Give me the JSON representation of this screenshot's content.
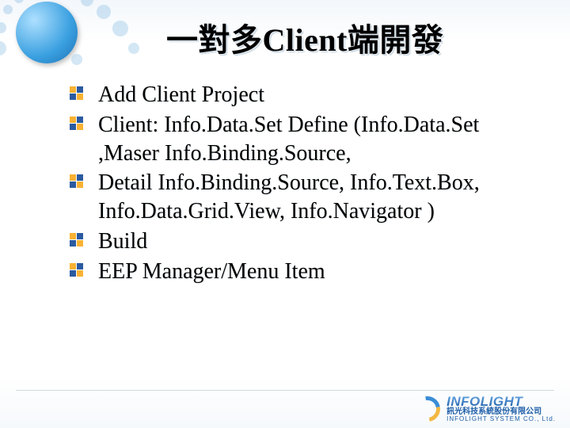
{
  "title": "一對多Client端開發",
  "bullets": [
    "Add Client Project",
    "Client: Info.Data.Set Define (Info.Data.Set ,Maser Info.Binding.Source,",
    "   Detail Info.Binding.Source, Info.Text.Box, Info.Data.Grid.View, Info.Navigator )",
    "Build",
    "EEP Manager/Menu Item"
  ],
  "footer": {
    "brand_latin": "INFOLIGHT",
    "brand_cn": "訊光科技系統股份有限公司",
    "brand_en": "INFOLIGHT SYSTEM CO., Ltd."
  }
}
